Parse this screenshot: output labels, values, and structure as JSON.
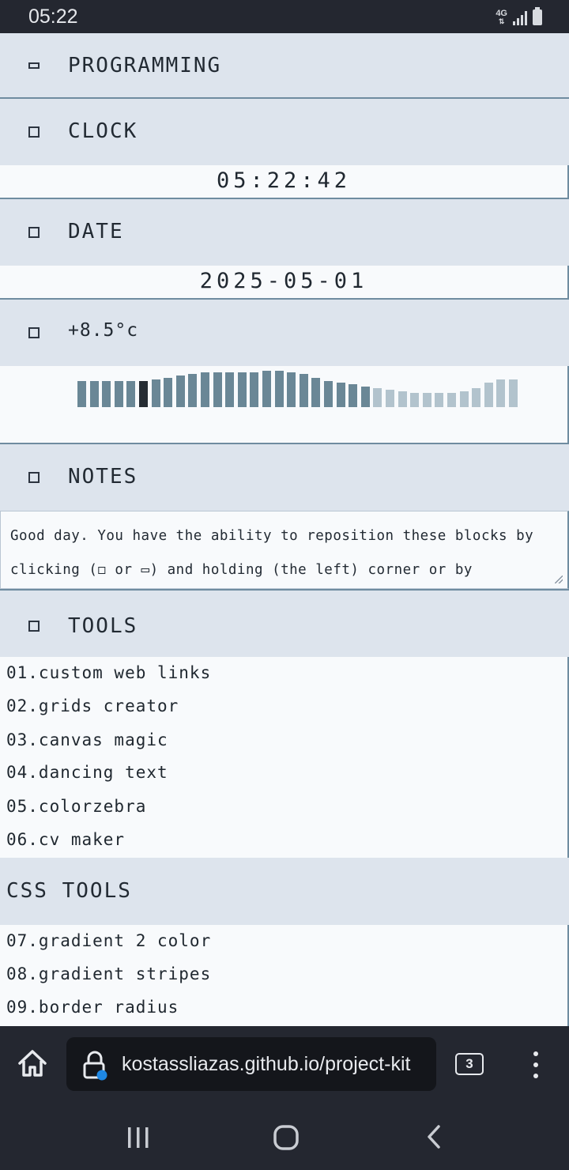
{
  "status_bar": {
    "time": "05:22",
    "network": "4G"
  },
  "sections": {
    "programming": {
      "title": "PROGRAMMING"
    },
    "clock": {
      "title": "CLOCK",
      "value": "05:22:42"
    },
    "date": {
      "title": "DATE",
      "value": "2025-05-01"
    },
    "weather": {
      "title": "+8.5°c"
    },
    "notes": {
      "title": "NOTES",
      "text": "Good day. You have the ability to reposition these blocks by clicking (◻ or ▭) and holding (the left) corner or by"
    },
    "tools": {
      "title": "TOOLS",
      "items": [
        "01.custom web links",
        "02.grids creator",
        "03.canvas magic",
        "04.dancing text",
        "05.colorzebra",
        "06.cv maker"
      ]
    },
    "css_tools": {
      "title": "CSS TOOLS",
      "items": [
        "07.gradient 2 color",
        "08.gradient stripes",
        "09.border radius"
      ]
    }
  },
  "temperature_chart": {
    "levels": [
      0.75,
      0.75,
      0.75,
      0.75,
      0.75,
      0.75,
      0.8,
      0.85,
      0.9,
      0.95,
      1.0,
      1.0,
      1.0,
      1.0,
      1.0,
      1.05,
      1.05,
      1.0,
      0.95,
      0.85,
      0.75,
      0.7,
      0.65,
      0.6,
      0.55,
      0.5,
      0.45,
      0.4,
      0.4,
      0.4,
      0.4,
      0.45,
      0.55,
      0.7,
      0.8,
      0.8
    ],
    "highlight_index": 5,
    "colors": {
      "past": "#6a8796",
      "current": "#262c33",
      "forecast": "#b2c3cd"
    },
    "forecast_from_index": 24
  },
  "browser": {
    "url": "kostassliazas.github.io/project-kit",
    "tab_count": "3",
    "icons": [
      "home-icon",
      "lock-icon",
      "tabs-icon",
      "more-vert-icon"
    ]
  },
  "navigation": {
    "icons": [
      "recent-apps-icon",
      "home-circle-icon",
      "back-icon"
    ]
  },
  "colors": {
    "header_bg": "#dde4ed",
    "divider": "#6f8ca0",
    "panel_bg": "#f8fafc",
    "chrome_bg": "#242730"
  }
}
